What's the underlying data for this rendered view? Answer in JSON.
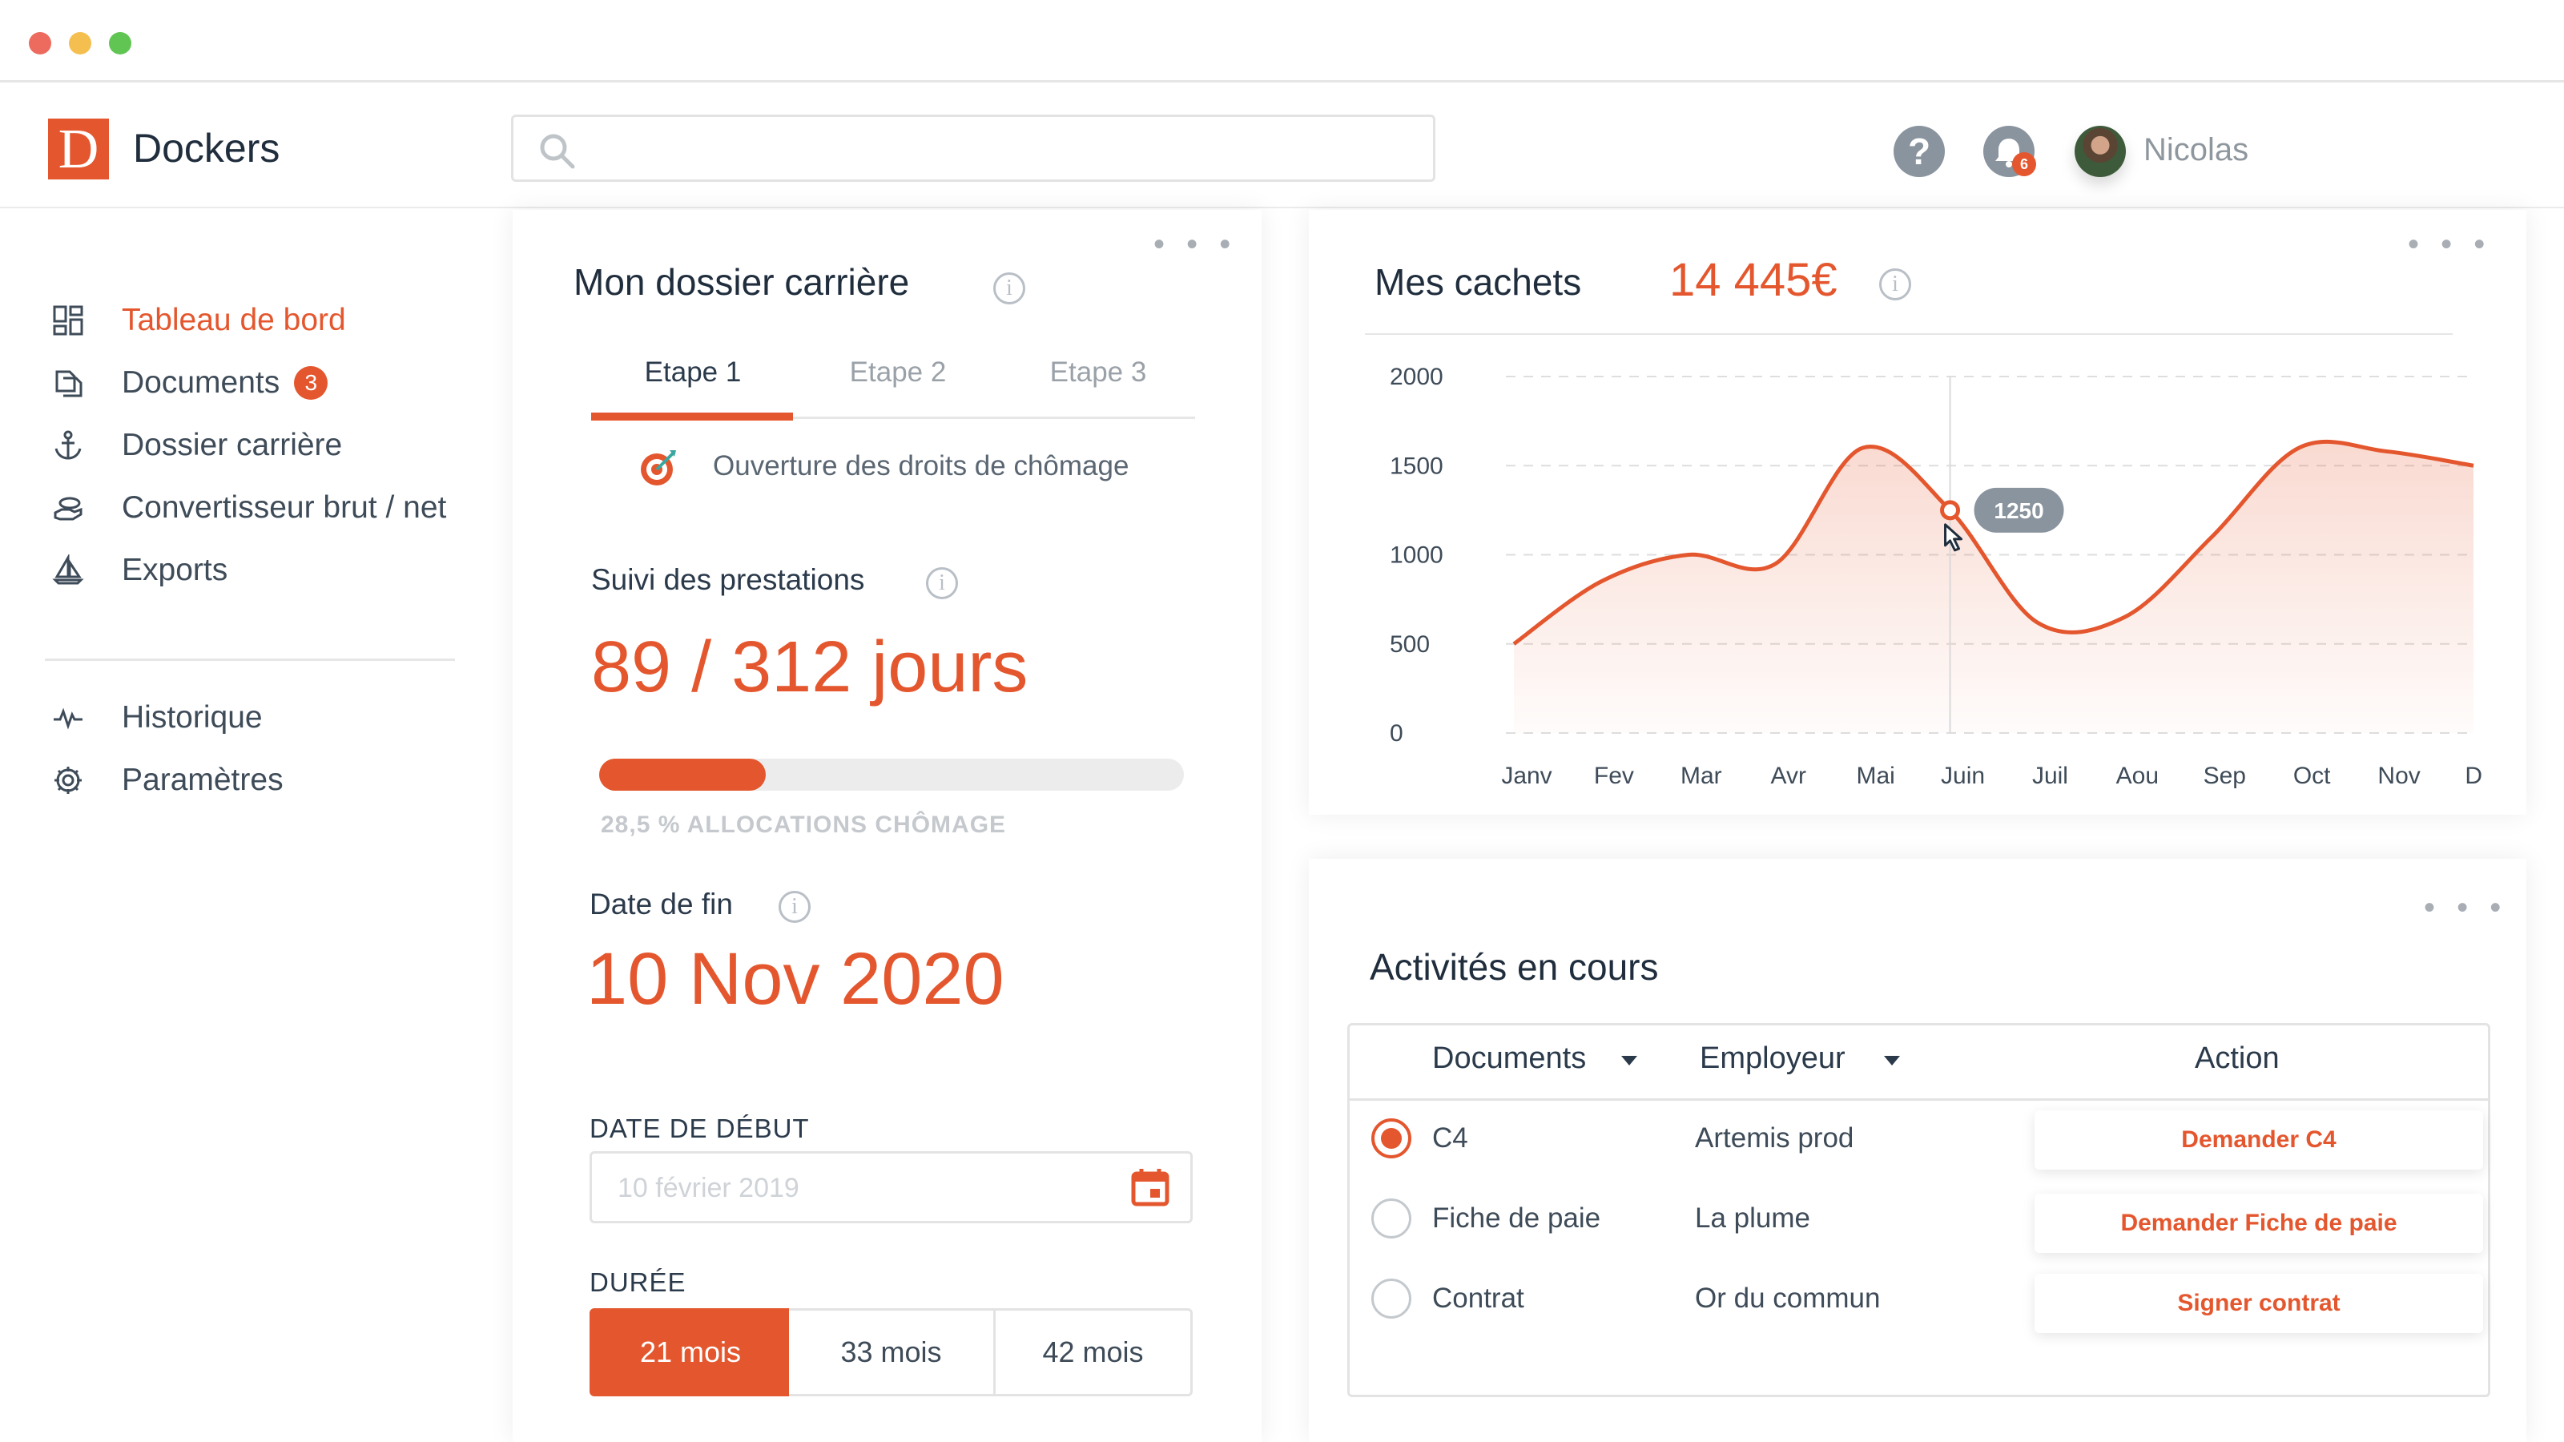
{
  "header": {
    "logo_letter": "D",
    "brand": "Dockers",
    "search_placeholder": "",
    "help_symbol": "?",
    "notifications_count": "6",
    "user_name": "Nicolas"
  },
  "sidebar": {
    "items": [
      {
        "label": "Tableau de bord",
        "icon": "dashboard-grid-icon",
        "active": true
      },
      {
        "label": "Documents",
        "icon": "documents-icon",
        "badge": "3"
      },
      {
        "label": "Dossier carrière",
        "icon": "anchor-icon"
      },
      {
        "label": "Convertisseur brut / net",
        "icon": "money-hand-icon"
      },
      {
        "label": "Exports",
        "icon": "sailboat-icon"
      }
    ],
    "secondary": [
      {
        "label": "Historique",
        "icon": "activity-pulse-icon"
      },
      {
        "label": "Paramètres",
        "icon": "gear-icon"
      }
    ]
  },
  "career": {
    "title": "Mon dossier carrière",
    "more": "• • •",
    "info": "i",
    "tabs": [
      "Etape 1",
      "Etape 2",
      "Etape 3"
    ],
    "active_tab": 0,
    "step_text": "Ouverture des droits de chômage",
    "tracking_title": "Suivi des prestations",
    "days": "89 / 312 jours",
    "progress_fraction": 0.285,
    "progress_label": "28,5 % ALLOCATIONS CHÔMAGE",
    "end_title": "Date de fin",
    "end_date": "10 Nov 2020",
    "start_label": "DATE DE DÉBUT",
    "start_value": "10 février 2019",
    "duration_label": "DURÉE",
    "durations": [
      "21 mois",
      "33 mois",
      "42 mois"
    ],
    "active_duration": 0
  },
  "cachets": {
    "title": "Mes cachets",
    "total": "14 445€",
    "more": "• • •",
    "info": "i",
    "tooltip": "1250"
  },
  "chart_data": {
    "type": "area",
    "title": "Mes cachets",
    "categories": [
      "Janv",
      "Fev",
      "Mar",
      "Avr",
      "Mai",
      "Juin",
      "Juil",
      "Aou",
      "Sep",
      "Oct",
      "Nov",
      "Dec"
    ],
    "values": [
      500,
      850,
      1000,
      950,
      1600,
      1250,
      620,
      650,
      1100,
      1600,
      1580,
      1500
    ],
    "yticks": [
      0,
      500,
      1000,
      1500,
      2000
    ],
    "ylim": [
      0,
      2000
    ],
    "highlight": {
      "value": 1250,
      "label": "1250"
    },
    "grid": true,
    "color": "#e4572e"
  },
  "activities": {
    "title": "Activités en cours",
    "more": "• • •",
    "columns": [
      "Documents",
      "Employeur",
      "Action"
    ],
    "rows": [
      {
        "doc": "C4",
        "employer": "Artemis prod",
        "action": "Demander C4",
        "selected": true
      },
      {
        "doc": "Fiche de paie",
        "employer": "La plume",
        "action": "Demander Fiche de paie",
        "selected": false
      },
      {
        "doc": "Contrat",
        "employer": "Or du commun",
        "action": "Signer contrat",
        "selected": false
      }
    ]
  },
  "colors": {
    "accent": "#e4572e",
    "muted": "#9aa1a8",
    "text": "#2b3a4b"
  }
}
